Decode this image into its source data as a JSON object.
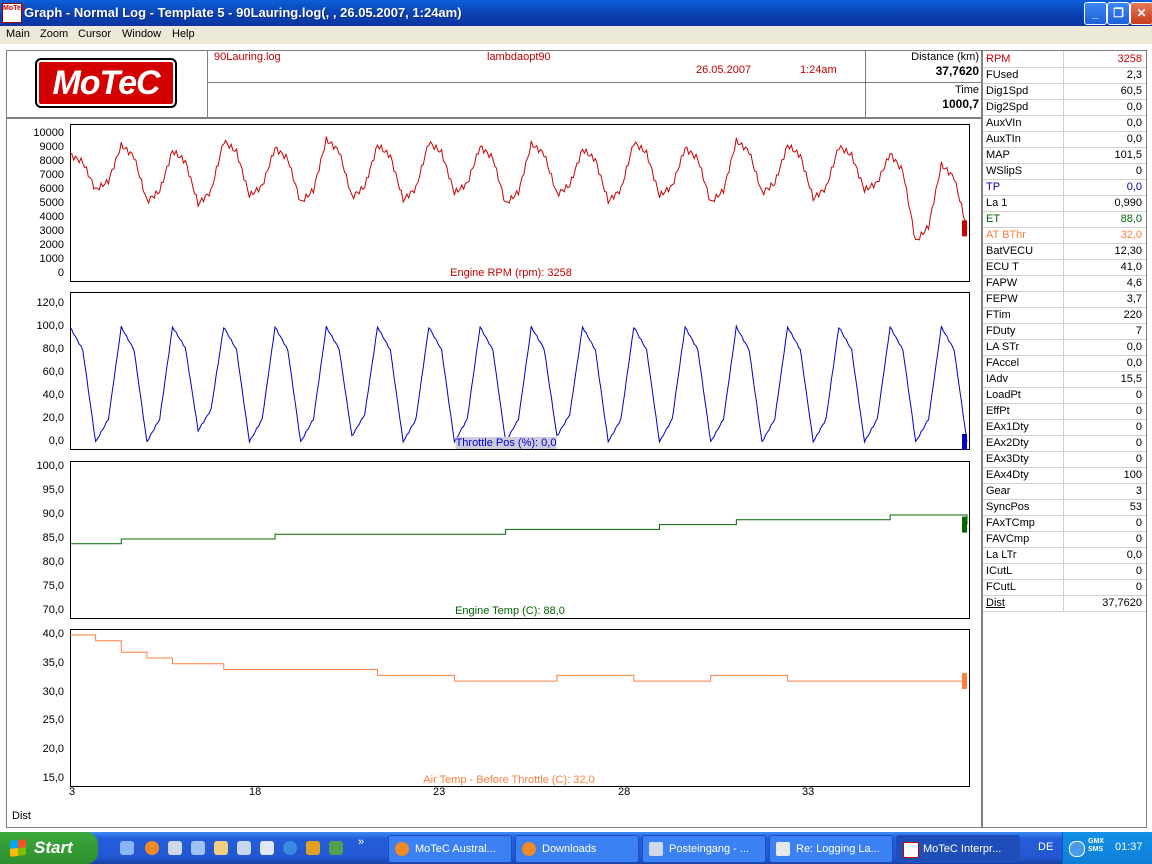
{
  "window": {
    "title": "Graph - Normal Log - Template 5 - 90Lauring.log(, , 26.05.2007,  1:24am)",
    "app_icon_text": "MoTeC"
  },
  "menu": [
    "Main",
    "Zoom",
    "Cursor",
    "Window",
    "Help"
  ],
  "header": {
    "logo": "MoTeC",
    "log_file": "90Lauring.log",
    "session": "lambdaopt90",
    "date": "26.05.2007",
    "time_of_day": "1:24am",
    "distance_label": "Distance (km)",
    "distance_value": "37,7620",
    "time_label": "Time",
    "time_value": "1000,7"
  },
  "colors": {
    "rpm": "#cc0000",
    "throttle": "#0000cc",
    "engine_temp": "#006600",
    "air_temp": "#ff6a1a",
    "blue_ch": "#000099",
    "green_ch": "#006600",
    "orange_ch": "#ff7f3f"
  },
  "x_axis": {
    "label": "Dist",
    "ticks": [
      "3",
      "18",
      "23",
      "28",
      "33"
    ]
  },
  "chart_data": [
    {
      "type": "line",
      "title": "Engine RPM (rpm): 3258",
      "ylim": [
        0,
        10000
      ],
      "yticks": [
        "10000",
        "9000",
        "8000",
        "7000",
        "6000",
        "5000",
        "4000",
        "3000",
        "2000",
        "1000",
        "0"
      ],
      "x": [
        3,
        4,
        5,
        6,
        7,
        8,
        9,
        10,
        11,
        12,
        13,
        14,
        15,
        16,
        17,
        18,
        19,
        20,
        21,
        22,
        23,
        24,
        25,
        26,
        27,
        28,
        29,
        30,
        31,
        32,
        33,
        34,
        35,
        36,
        37,
        38
      ],
      "values": [
        8500,
        6000,
        9200,
        5200,
        8800,
        5000,
        9500,
        5600,
        9000,
        5100,
        9600,
        5500,
        9200,
        5300,
        9400,
        5800,
        9100,
        5000,
        9300,
        5700,
        8900,
        5200,
        9400,
        5600,
        9000,
        5100,
        9500,
        5800,
        9200,
        5400,
        9100,
        6000,
        8600,
        2300,
        7800,
        3258
      ]
    },
    {
      "type": "line",
      "title": "Throttle Pos (%): 0,0",
      "ylim": [
        0,
        120
      ],
      "yticks": [
        "120,0",
        "100,0",
        "80,0",
        "60,0",
        "40,0",
        "20,0",
        "0,0"
      ],
      "x": [
        3,
        4,
        5,
        6,
        7,
        8,
        9,
        10,
        11,
        12,
        13,
        14,
        15,
        16,
        17,
        18,
        19,
        20,
        21,
        22,
        23,
        24,
        25,
        26,
        27,
        28,
        29,
        30,
        31,
        32,
        33,
        34,
        35,
        36,
        37,
        38
      ],
      "values": [
        100,
        0,
        100,
        0,
        100,
        10,
        100,
        0,
        100,
        0,
        100,
        5,
        100,
        0,
        100,
        0,
        100,
        0,
        100,
        5,
        100,
        0,
        100,
        0,
        100,
        0,
        100,
        0,
        100,
        0,
        100,
        0,
        100,
        0,
        100,
        0
      ]
    },
    {
      "type": "line",
      "title": "Engine Temp (C): 88,0",
      "ylim": [
        70,
        100
      ],
      "yticks": [
        "100,0",
        "95,0",
        "90,0",
        "85,0",
        "80,0",
        "75,0",
        "70,0"
      ],
      "x": [
        3,
        5,
        8,
        11,
        14,
        17,
        20,
        23,
        26,
        29,
        32,
        35,
        38
      ],
      "values": [
        84,
        85,
        85,
        86,
        86,
        86,
        87,
        87,
        88,
        89,
        89,
        90,
        88
      ]
    },
    {
      "type": "line",
      "title": "Air Temp - Before Throttle (C): 32,0",
      "ylim": [
        15,
        40
      ],
      "yticks": [
        "40,0",
        "35,0",
        "30,0",
        "25,0",
        "20,0",
        "15,0"
      ],
      "x": [
        3,
        4,
        5,
        6,
        7,
        9,
        12,
        15,
        18,
        22,
        25,
        28,
        31,
        35,
        38
      ],
      "values": [
        41,
        39,
        37,
        36,
        35,
        34,
        34,
        33,
        32,
        33,
        32,
        33,
        32,
        32,
        32
      ]
    }
  ],
  "channels": [
    {
      "name": "RPM",
      "value": "3258",
      "color": "#cc0000"
    },
    {
      "name": "FUsed",
      "value": "2,3",
      "color": "#000000"
    },
    {
      "name": "Dig1Spd",
      "value": "60,5",
      "color": "#000000"
    },
    {
      "name": "Dig2Spd",
      "value": "0,0",
      "color": "#000000"
    },
    {
      "name": "AuxVIn",
      "value": "0,0",
      "color": "#000000"
    },
    {
      "name": "AuxTIn",
      "value": "0,0",
      "color": "#000000"
    },
    {
      "name": "MAP",
      "value": "101,5",
      "color": "#000000"
    },
    {
      "name": "WSlipS",
      "value": "0",
      "color": "#000000"
    },
    {
      "name": "TP",
      "value": "0,0",
      "color": "#000099"
    },
    {
      "name": "La 1",
      "value": "0,990",
      "color": "#000000"
    },
    {
      "name": "ET",
      "value": "88,0",
      "color": "#006600"
    },
    {
      "name": "AT BThr",
      "value": "32,0",
      "color": "#ff7f3f"
    },
    {
      "name": "BatVECU",
      "value": "12,30",
      "color": "#000000"
    },
    {
      "name": "ECU T",
      "value": "41,0",
      "color": "#000000"
    },
    {
      "name": "FAPW",
      "value": "4,6",
      "color": "#000000"
    },
    {
      "name": "FEPW",
      "value": "3,7",
      "color": "#000000"
    },
    {
      "name": "FTim",
      "value": "220",
      "color": "#000000"
    },
    {
      "name": "FDuty",
      "value": "7",
      "color": "#000000"
    },
    {
      "name": "LA STr",
      "value": "0,0",
      "color": "#000000"
    },
    {
      "name": "FAccel",
      "value": "0,0",
      "color": "#000000"
    },
    {
      "name": "IAdv",
      "value": "15,5",
      "color": "#000000"
    },
    {
      "name": "LoadPt",
      "value": "0",
      "color": "#000000"
    },
    {
      "name": "EffPt",
      "value": "0",
      "color": "#000000"
    },
    {
      "name": "EAx1Dty",
      "value": "0",
      "color": "#000000"
    },
    {
      "name": "EAx2Dty",
      "value": "0",
      "color": "#000000"
    },
    {
      "name": "EAx3Dty",
      "value": "0",
      "color": "#000000"
    },
    {
      "name": "EAx4Dty",
      "value": "100",
      "color": "#000000"
    },
    {
      "name": "Gear",
      "value": "3",
      "color": "#000000"
    },
    {
      "name": "SyncPos",
      "value": "53",
      "color": "#000000"
    },
    {
      "name": "FAxTCmp",
      "value": "0",
      "color": "#000000"
    },
    {
      "name": "FAVCmp",
      "value": "0",
      "color": "#000000"
    },
    {
      "name": "La LTr",
      "value": "0,0",
      "color": "#000000"
    },
    {
      "name": "ICutL",
      "value": "0",
      "color": "#000000"
    },
    {
      "name": "FCutL",
      "value": "0",
      "color": "#000000"
    },
    {
      "name": "Dist",
      "value": "37,7620",
      "color": "#000000"
    }
  ],
  "taskbar": {
    "start": "Start",
    "items": [
      "MoTeC Austral...",
      "Downloads",
      "Posteingang - ...",
      "Re: Logging La...",
      "MoTeC Interpr..."
    ],
    "lang": "DE",
    "tray_badge": "GMX SMS",
    "clock": "01:37"
  }
}
